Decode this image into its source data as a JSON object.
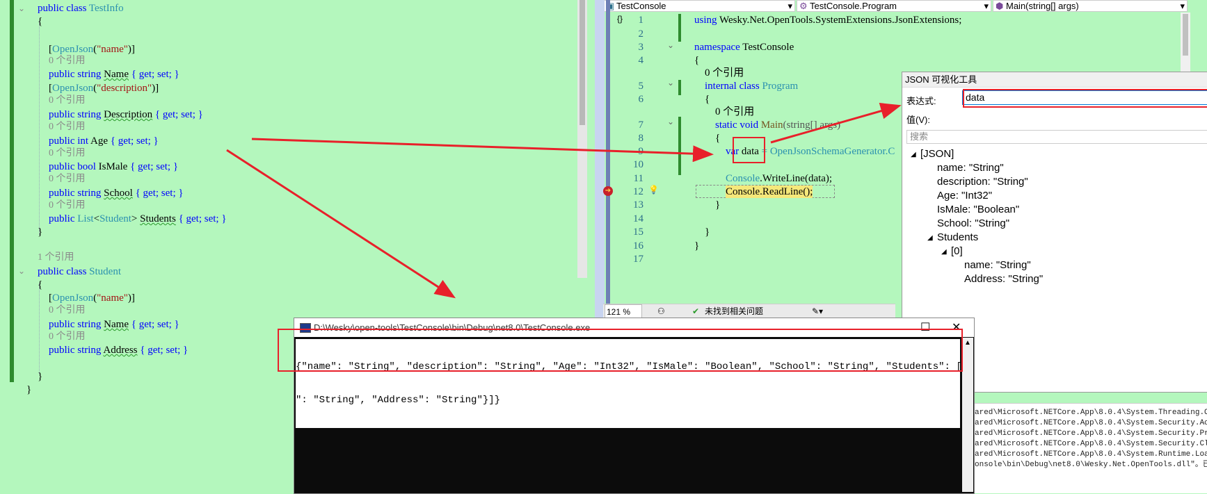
{
  "left_editor": {
    "refs": {
      "zero": "0 个引用",
      "one": "1 个引用"
    },
    "testinfo": {
      "decl_kw": "public class",
      "decl_name": "TestInfo",
      "open_brace": "{",
      "close_brace": "}",
      "attr_name": "OpenJson",
      "attr_name_arg": "\"name\"",
      "attr_desc_arg": "\"description\"",
      "props": [
        {
          "mods": "public string",
          "name": "Name",
          "accessor": "{ get; set; }"
        },
        {
          "mods": "public string",
          "name": "Description",
          "accessor": "{ get; set; }"
        },
        {
          "mods": "public int",
          "name": "Age",
          "accessor": "{ get; set; }"
        },
        {
          "mods": "public bool",
          "name": "IsMale",
          "accessor": "{ get; set; }"
        },
        {
          "mods": "public string",
          "name": "School",
          "accessor": "{ get; set; }"
        },
        {
          "mods": "public",
          "type": "List",
          "type_arg": "Student",
          "name": "Students",
          "accessor": "{ get; set; }"
        }
      ]
    },
    "student": {
      "decl_kw": "public class",
      "decl_name": "Student",
      "open_brace": "{",
      "close_brace": "}",
      "outer_close": "}",
      "attr_name": "OpenJson",
      "attr_name_arg": "\"name\"",
      "props": [
        {
          "mods": "public string",
          "name": "Name",
          "accessor": "{ get; set; }"
        },
        {
          "mods": "public string",
          "name": "Address",
          "accessor": "{ get; set; }"
        }
      ]
    }
  },
  "right_editor": {
    "dropdowns": {
      "project": "TestConsole",
      "class": "TestConsole.Program",
      "member": "Main(string[] args)"
    },
    "line_numbers": [
      "1",
      "2",
      "3",
      "4",
      "5",
      "6",
      "7",
      "8",
      "9",
      "10",
      "11",
      "12",
      "13",
      "14",
      "15",
      "16",
      "17"
    ],
    "code": {
      "using_kw": "using",
      "using_ns": "Wesky.Net.OpenTools.SystemExtensions.JsonExtensions;",
      "ns_kw": "namespace",
      "ns_name": "TestConsole",
      "brace_open": "{",
      "brace_close": "}",
      "ref0": "0 个引用",
      "class_kw": "internal class",
      "class_name": "Program",
      "main_kw": "static void",
      "main_name": "Main",
      "main_params": "(string[] args)",
      "var_kw": "var",
      "var_name": "data",
      "var_rhs": "= OpenJsonSchemaGenerator.C",
      "console": "Console",
      "writeline": ".WriteLine(data);",
      "readline": "Console.ReadLine();"
    },
    "status": {
      "zoom": "121 %",
      "issues": "未找到相关问题"
    }
  },
  "json_visualizer": {
    "title": "JSON 可视化工具",
    "expression_label": "表达式:",
    "expression_value": "data",
    "value_label": "值(V):",
    "search_placeholder": "搜索",
    "root": "[JSON]",
    "nodes": [
      "name: \"String\"",
      "description: \"String\"",
      "Age: \"Int32\"",
      "IsMale: \"Boolean\"",
      "School: \"String\""
    ],
    "students_node": "Students",
    "index_node": "[0]",
    "child_nodes": [
      "name: \"String\"",
      "Address: \"String\""
    ]
  },
  "console": {
    "title": "D:\\Wesky\\open-tools\\TestConsole\\bin\\Debug\\net8.0\\TestConsole.exe",
    "output_line1": "{\"name\": \"String\", \"description\": \"String\", \"Age\": \"Int32\", \"IsMale\": \"Boolean\", \"School\": \"String\", \"Students\": [{\"name",
    "output_line2": "\": \"String\", \"Address\": \"String\"}]}"
  },
  "output_pane": {
    "lines": [
      "ared\\Microsoft.NETCore.App\\8.0.4\\System.Threading.Overl",
      "ared\\Microsoft.NETCore.App\\8.0.4\\System.Security.Access",
      "ared\\Microsoft.NETCore.App\\8.0.4\\System.Security.Princip",
      "ared\\Microsoft.NETCore.App\\8.0.4\\System.Security.Claims.",
      "ared\\Microsoft.NETCore.App\\8.0.4\\System.Runtime.Loader.",
      "onsole\\bin\\Debug\\net8.0\\Wesky.Net.OpenTools.dll\"。已跳过"
    ]
  },
  "colors": {
    "editor_bg": "#b4f7bd",
    "keyword": "#0000ff",
    "type": "#2b91af",
    "string": "#a31515",
    "annotation_red": "#e8202a"
  }
}
